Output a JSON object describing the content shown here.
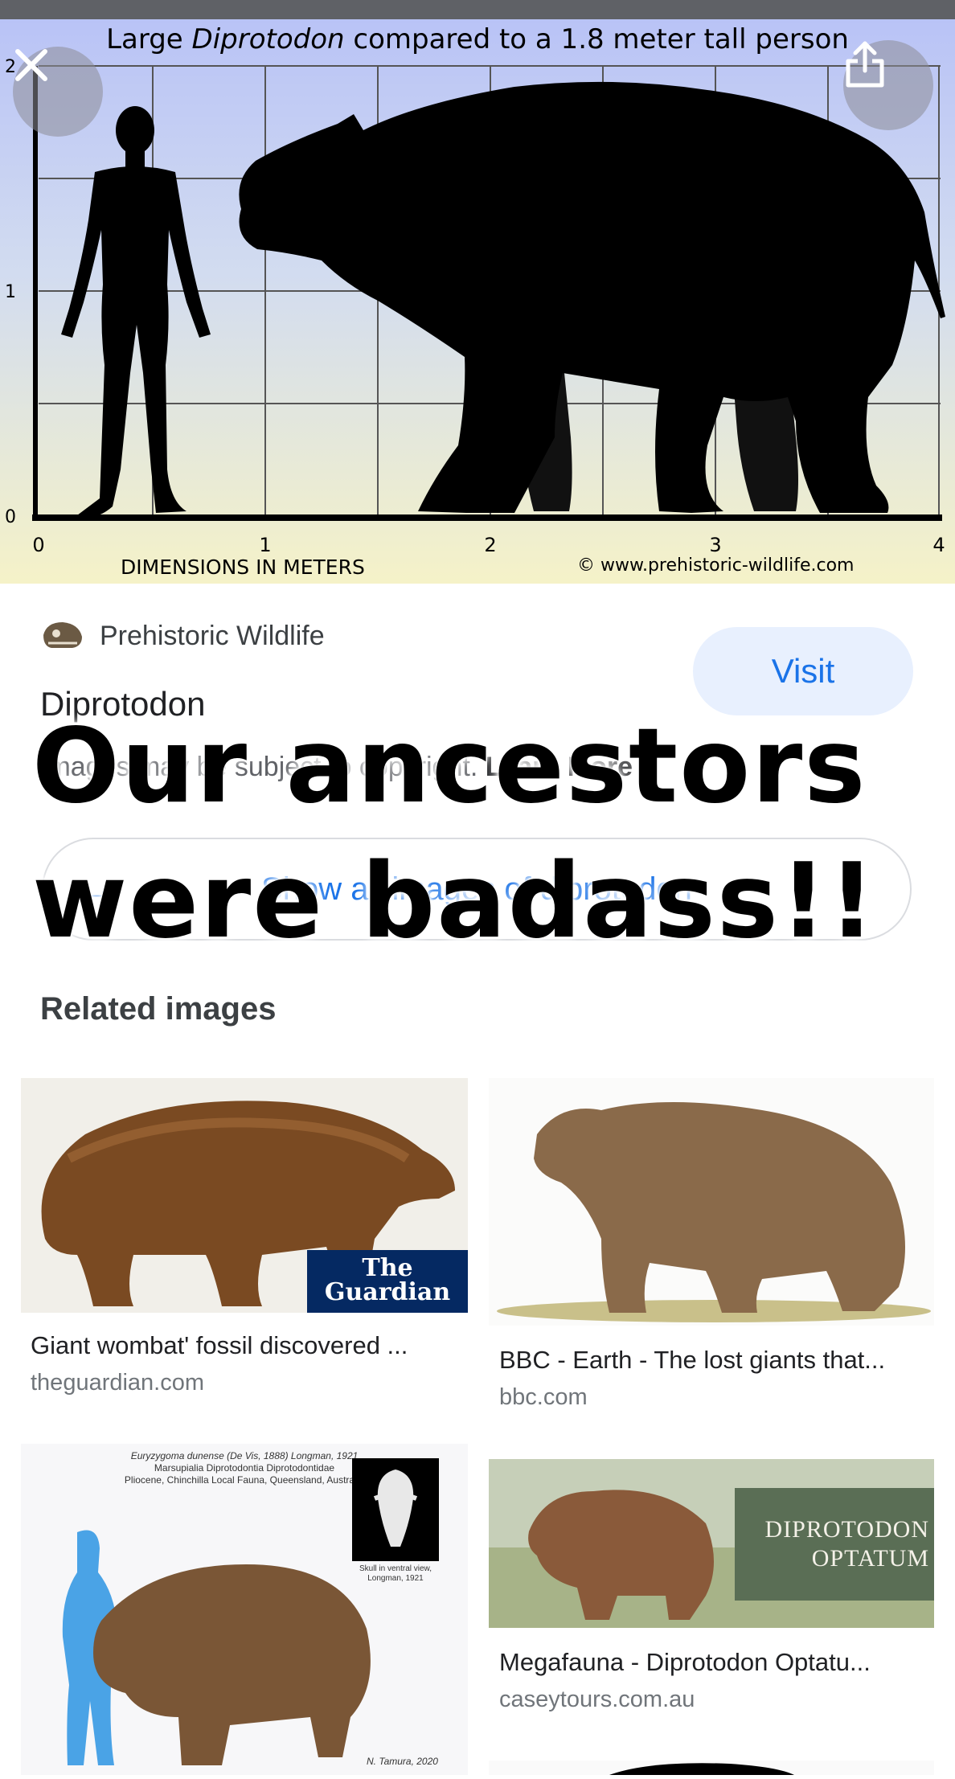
{
  "hero": {
    "title_pre": "Large ",
    "title_italic": "Diprotodon",
    "title_post": " compared to a 1.8 meter tall person",
    "y_ticks": [
      "2",
      "1",
      "0"
    ],
    "x_ticks": [
      "0",
      "1",
      "2",
      "3",
      "4"
    ],
    "axis_label": "DIMENSIONS IN METERS",
    "credit": "© www.prehistoric-wildlife.com",
    "close_icon": "close-icon",
    "share_icon": "share-icon"
  },
  "result": {
    "source_icon": "skull-icon",
    "source_name": "Prehistoric Wildlife",
    "title": "Diprotodon",
    "copyright_text": "Images may be subject to copyright. ",
    "learn_more": "Learn More",
    "visit_label": "Visit",
    "show_all_icon": "arrow-right-icon",
    "show_all_label": "Show all images of diprotodon"
  },
  "related": {
    "heading": "Related images",
    "cards": [
      {
        "caption": "Giant wombat' fossil discovered ...",
        "domain": "theguardian.com",
        "badge": [
          "The",
          "Guardian"
        ]
      },
      {
        "caption": "BBC - Earth - The lost giants that...",
        "domain": "bbc.com"
      },
      {
        "caption": "",
        "domain": "",
        "fig_lines": [
          "Euryzygoma dunense (De Vis, 1888) Longman, 1921",
          "Marsupialia Diprotodontia Diprotodontidae",
          "Pliocene, Chinchilla Local Fauna, Queensland, Australia"
        ],
        "inset_caption": [
          "Skull in ventral view,",
          "Longman, 1921"
        ],
        "signature": "N. Tamura, 2020"
      },
      {
        "caption": "Megafauna - Diprotodon Optatu...",
        "domain": "caseytours.com.au",
        "overlay": [
          "DIPROTODON",
          "OPTATUM"
        ]
      }
    ]
  },
  "meme": {
    "line1": "Our ancestors",
    "line2": "were badass!!"
  },
  "colors": {
    "accent": "#1a73e8",
    "visit_bg": "#e8f0fe",
    "guardian_blue": "#052962",
    "optatum_green": "#5a6e55"
  }
}
